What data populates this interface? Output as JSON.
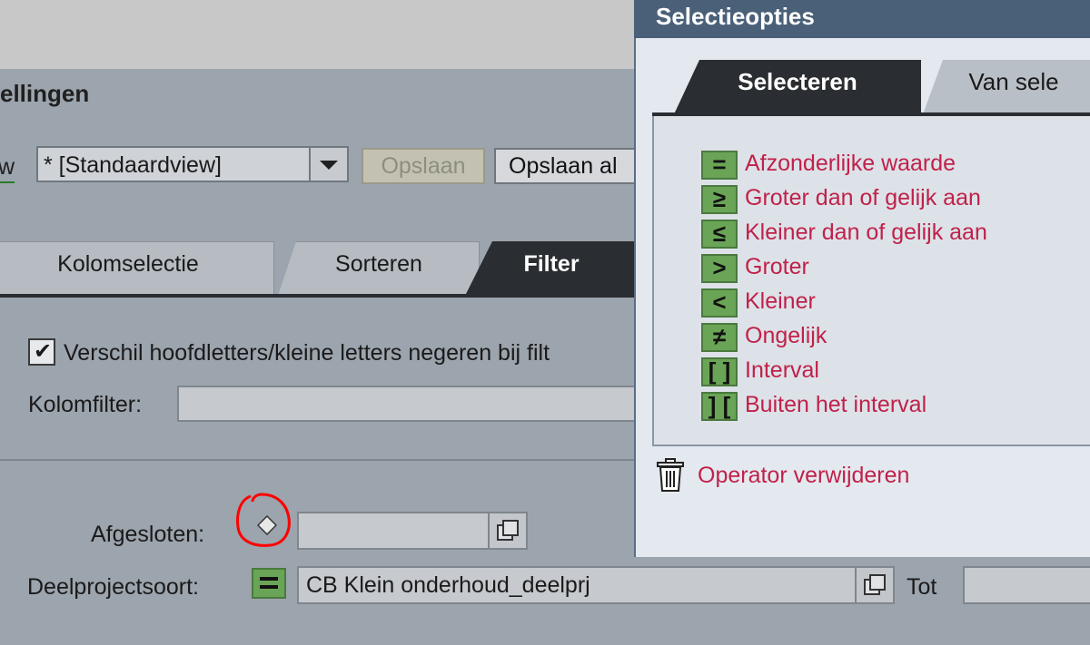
{
  "dialog": {
    "title": "ellingen",
    "view_label": "w",
    "view_value": "* [Standaardview]",
    "save_label": "Opslaan",
    "save_as_label": "Opslaan al",
    "tabs": [
      {
        "label": "Kolomselectie"
      },
      {
        "label": "Sorteren"
      },
      {
        "label": "Filter",
        "active": true
      }
    ],
    "filter": {
      "case_checkbox_label": "Verschil hoofdletters/kleine letters negeren bij filt",
      "case_checked": true,
      "column_filter_label": "Kolomfilter:",
      "column_filter_value": ""
    },
    "fields": {
      "afgesloten_label": "Afgesloten:",
      "afgesloten_value": "",
      "deelprojectsoort_label": "Deelprojectsoort:",
      "deelprojectsoort_operator": "=",
      "deelprojectsoort_value": "CB Klein onderhoud_deelprj",
      "tot_label": "Tot",
      "tot_value": ""
    }
  },
  "popup": {
    "title": "Selectieopties",
    "tabs": [
      {
        "label": "Selecteren",
        "active": true
      },
      {
        "label": "Van sele"
      }
    ],
    "operators": [
      {
        "symbol": "=",
        "label": "Afzonderlijke waarde",
        "icon": "equals-icon"
      },
      {
        "symbol": "≥",
        "label": "Groter dan of gelijk aan",
        "icon": "greater-equal-icon"
      },
      {
        "symbol": "≤",
        "label": "Kleiner dan of gelijk aan",
        "icon": "less-equal-icon"
      },
      {
        "symbol": ">",
        "label": "Groter",
        "icon": "greater-icon"
      },
      {
        "symbol": "<",
        "label": "Kleiner",
        "icon": "less-icon"
      },
      {
        "symbol": "≠",
        "label": "Ongelijk",
        "icon": "not-equal-icon"
      },
      {
        "symbol": "[ ]",
        "label": "Interval",
        "icon": "interval-icon"
      },
      {
        "symbol": "] [",
        "label": "Buiten het interval",
        "icon": "outside-interval-icon"
      }
    ],
    "remove_label": "Operator verwijderen"
  },
  "colors": {
    "operator_green": "#6aa456",
    "link_red": "#c0214a",
    "popup_header": "#4a6078",
    "active_tab": "#2a2d31",
    "annotation_red": "#ff0000"
  }
}
